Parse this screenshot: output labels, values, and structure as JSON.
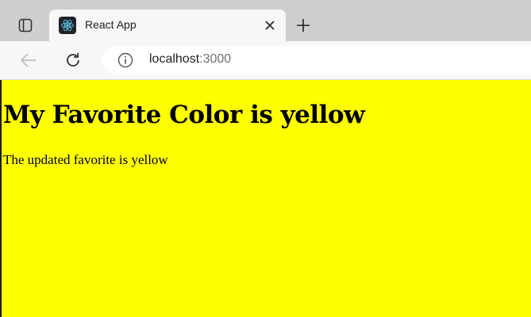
{
  "browser": {
    "tab": {
      "title": "React App",
      "favicon": "react-logo-icon"
    },
    "address": {
      "host": "localhost",
      "port": ":3000"
    },
    "icons": [
      "tab-actions-icon",
      "close-icon",
      "plus-icon",
      "back-arrow-icon",
      "reload-icon",
      "info-icon"
    ]
  },
  "page": {
    "background_color": "#ffff00",
    "heading": "My Favorite Color is yellow",
    "text": "The updated favorite is yellow"
  }
}
